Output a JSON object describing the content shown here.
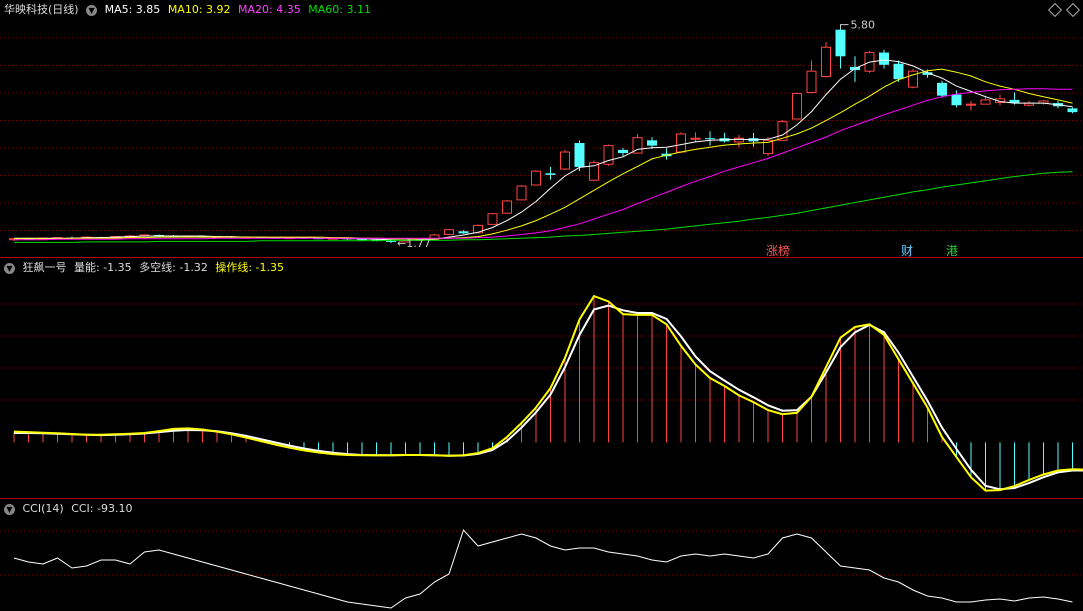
{
  "header": {
    "stock_name": "华映科技(日线)",
    "ma5_label": "MA5: 3.85",
    "ma10_label": "MA10: 3.92",
    "ma20_label": "MA20: 4.35",
    "ma60_label": "MA60: 3.11"
  },
  "indicator1": {
    "name": "狂飙一号",
    "liang_label": "量能: -1.35",
    "duokong_label": "多空线: -1.32",
    "caozuo_label": "操作线: -1.35"
  },
  "indicator2": {
    "name": "CCI(14)",
    "cci_label": "CCI: -93.10"
  },
  "markers": {
    "high_label": "5.80",
    "low_label": "1.77",
    "zhangbang": "涨榜",
    "cai": "财",
    "gang": "港"
  },
  "colors": {
    "up": "#ff4444",
    "down": "#54ffff",
    "ma5": "#ffffff",
    "ma10": "#ffff00",
    "ma20": "#ff00ff",
    "ma60": "#00dd00",
    "grid": "#7a0000"
  },
  "chart_data": [
    {
      "type": "candlestick",
      "title": "华映科技(日线)",
      "ylim": [
        1.6,
        6.0
      ],
      "high_annotation": 5.8,
      "low_annotation": 1.77,
      "candles": [
        [
          1.83,
          1.85,
          1.81,
          1.86
        ],
        [
          1.85,
          1.84,
          1.83,
          1.87
        ],
        [
          1.84,
          1.86,
          1.83,
          1.87
        ],
        [
          1.86,
          1.87,
          1.85,
          1.88
        ],
        [
          1.87,
          1.86,
          1.85,
          1.89
        ],
        [
          1.86,
          1.88,
          1.85,
          1.89
        ],
        [
          1.88,
          1.87,
          1.86,
          1.89
        ],
        [
          1.87,
          1.89,
          1.86,
          1.9
        ],
        [
          1.89,
          1.9,
          1.88,
          1.92
        ],
        [
          1.9,
          1.92,
          1.89,
          1.93
        ],
        [
          1.92,
          1.9,
          1.89,
          1.93
        ],
        [
          1.9,
          1.89,
          1.88,
          1.92
        ],
        [
          1.89,
          1.9,
          1.88,
          1.91
        ],
        [
          1.9,
          1.88,
          1.87,
          1.91
        ],
        [
          1.88,
          1.89,
          1.87,
          1.9
        ],
        [
          1.89,
          1.87,
          1.86,
          1.9
        ],
        [
          1.87,
          1.88,
          1.86,
          1.89
        ],
        [
          1.88,
          1.87,
          1.86,
          1.89
        ],
        [
          1.87,
          1.86,
          1.85,
          1.88
        ],
        [
          1.86,
          1.87,
          1.85,
          1.88
        ],
        [
          1.87,
          1.86,
          1.85,
          1.88
        ],
        [
          1.86,
          1.85,
          1.84,
          1.87
        ],
        [
          1.85,
          1.86,
          1.84,
          1.87
        ],
        [
          1.86,
          1.84,
          1.83,
          1.87
        ],
        [
          1.84,
          1.83,
          1.82,
          1.85
        ],
        [
          1.83,
          1.81,
          1.8,
          1.84
        ],
        [
          1.81,
          1.79,
          1.77,
          1.82
        ],
        [
          1.79,
          1.82,
          1.78,
          1.83
        ],
        [
          1.82,
          1.84,
          1.81,
          1.85
        ],
        [
          1.84,
          1.92,
          1.84,
          1.94
        ],
        [
          1.93,
          2.02,
          1.92,
          2.03
        ],
        [
          1.99,
          1.95,
          1.94,
          2.01
        ],
        [
          1.96,
          2.1,
          1.96,
          2.12
        ],
        [
          2.12,
          2.32,
          2.12,
          2.33
        ],
        [
          2.33,
          2.56,
          2.32,
          2.58
        ],
        [
          2.58,
          2.84,
          2.58,
          2.86
        ],
        [
          2.86,
          3.12,
          2.86,
          3.14
        ],
        [
          3.08,
          3.05,
          2.96,
          3.2
        ],
        [
          3.16,
          3.48,
          3.14,
          3.52
        ],
        [
          3.65,
          3.2,
          3.12,
          3.7
        ],
        [
          2.95,
          3.28,
          2.93,
          3.32
        ],
        [
          3.25,
          3.6,
          3.22,
          3.62
        ],
        [
          3.52,
          3.46,
          3.4,
          3.56
        ],
        [
          3.46,
          3.75,
          3.45,
          3.82
        ],
        [
          3.7,
          3.6,
          3.54,
          3.76
        ],
        [
          3.45,
          3.4,
          3.34,
          3.55
        ],
        [
          3.48,
          3.82,
          3.46,
          3.85
        ],
        [
          3.72,
          3.74,
          3.66,
          3.85
        ],
        [
          3.74,
          3.73,
          3.6,
          3.87
        ],
        [
          3.74,
          3.68,
          3.66,
          3.84
        ],
        [
          3.67,
          3.74,
          3.56,
          3.8
        ],
        [
          3.74,
          3.68,
          3.58,
          3.84
        ],
        [
          3.45,
          3.7,
          3.4,
          3.76
        ],
        [
          3.7,
          4.05,
          3.7,
          4.08
        ],
        [
          4.1,
          4.58,
          4.1,
          4.6
        ],
        [
          4.6,
          5.0,
          4.58,
          5.2
        ],
        [
          4.9,
          5.45,
          4.88,
          5.55
        ],
        [
          5.78,
          5.28,
          5.05,
          5.8
        ],
        [
          5.08,
          5.02,
          4.8,
          5.28
        ],
        [
          5.0,
          5.35,
          4.97,
          5.38
        ],
        [
          5.35,
          5.12,
          5.05,
          5.4
        ],
        [
          5.14,
          4.85,
          4.8,
          5.2
        ],
        [
          4.7,
          5.0,
          4.68,
          5.04
        ],
        [
          4.98,
          4.93,
          4.88,
          5.03
        ],
        [
          4.78,
          4.54,
          4.5,
          4.82
        ],
        [
          4.56,
          4.36,
          4.32,
          4.64
        ],
        [
          4.36,
          4.38,
          4.26,
          4.44
        ],
        [
          4.38,
          4.46,
          4.38,
          4.54
        ],
        [
          4.41,
          4.48,
          4.36,
          4.56
        ],
        [
          4.46,
          4.4,
          4.37,
          4.6
        ],
        [
          4.36,
          4.4,
          4.34,
          4.44
        ],
        [
          4.4,
          4.44,
          4.37,
          4.46
        ],
        [
          4.4,
          4.34,
          4.3,
          4.44
        ],
        [
          4.3,
          4.23,
          4.21,
          4.32
        ]
      ],
      "series": [
        {
          "name": "MA5",
          "color": "#ffffff",
          "values": [
            1.86,
            1.86,
            1.86,
            1.86,
            1.86,
            1.87,
            1.87,
            1.88,
            1.89,
            1.9,
            1.9,
            1.9,
            1.9,
            1.9,
            1.89,
            1.89,
            1.88,
            1.88,
            1.87,
            1.87,
            1.87,
            1.86,
            1.86,
            1.85,
            1.85,
            1.84,
            1.83,
            1.82,
            1.82,
            1.84,
            1.88,
            1.92,
            1.97,
            2.06,
            2.19,
            2.35,
            2.55,
            2.8,
            3.03,
            3.19,
            3.22,
            3.32,
            3.39,
            3.53,
            3.56,
            3.57,
            3.62,
            3.67,
            3.7,
            3.71,
            3.72,
            3.71,
            3.72,
            3.8,
            3.99,
            4.24,
            4.56,
            4.85,
            5.05,
            5.17,
            5.21,
            5.18,
            5.1,
            4.97,
            4.87,
            4.72,
            4.62,
            4.52,
            4.43,
            4.4,
            4.4,
            4.4,
            4.37,
            4.33
          ]
        },
        {
          "name": "MA10",
          "color": "#ffff00",
          "values": [
            1.85,
            1.85,
            1.85,
            1.85,
            1.86,
            1.86,
            1.86,
            1.86,
            1.87,
            1.87,
            1.88,
            1.88,
            1.88,
            1.88,
            1.88,
            1.88,
            1.88,
            1.88,
            1.88,
            1.88,
            1.88,
            1.88,
            1.87,
            1.87,
            1.86,
            1.86,
            1.85,
            1.85,
            1.84,
            1.85,
            1.86,
            1.87,
            1.89,
            1.94,
            2.01,
            2.09,
            2.19,
            2.31,
            2.44,
            2.6,
            2.76,
            2.92,
            3.07,
            3.21,
            3.35,
            3.42,
            3.48,
            3.53,
            3.57,
            3.61,
            3.63,
            3.65,
            3.66,
            3.74,
            3.82,
            3.93,
            4.07,
            4.22,
            4.38,
            4.53,
            4.7,
            4.84,
            4.93,
            5.01,
            5.04,
            4.98,
            4.91,
            4.8,
            4.72,
            4.66,
            4.58,
            4.52,
            4.46,
            4.4
          ]
        },
        {
          "name": "MA20",
          "color": "#ff00ff",
          "values": [
            1.83,
            1.83,
            1.83,
            1.84,
            1.84,
            1.84,
            1.84,
            1.84,
            1.85,
            1.85,
            1.85,
            1.85,
            1.85,
            1.85,
            1.86,
            1.86,
            1.86,
            1.86,
            1.86,
            1.86,
            1.86,
            1.86,
            1.86,
            1.86,
            1.86,
            1.86,
            1.86,
            1.86,
            1.86,
            1.86,
            1.86,
            1.86,
            1.87,
            1.88,
            1.9,
            1.93,
            1.96,
            2.0,
            2.06,
            2.13,
            2.22,
            2.31,
            2.4,
            2.51,
            2.62,
            2.72,
            2.83,
            2.93,
            3.02,
            3.12,
            3.2,
            3.28,
            3.36,
            3.46,
            3.56,
            3.66,
            3.76,
            3.88,
            3.98,
            4.08,
            4.18,
            4.27,
            4.36,
            4.45,
            4.52,
            4.57,
            4.6,
            4.63,
            4.65,
            4.66,
            4.67,
            4.67,
            4.66,
            4.66
          ]
        },
        {
          "name": "MA60",
          "color": "#00dd00",
          "values": [
            1.78,
            1.78,
            1.78,
            1.78,
            1.78,
            1.79,
            1.79,
            1.79,
            1.79,
            1.79,
            1.8,
            1.8,
            1.8,
            1.8,
            1.8,
            1.8,
            1.8,
            1.81,
            1.81,
            1.81,
            1.81,
            1.81,
            1.81,
            1.81,
            1.81,
            1.81,
            1.82,
            1.82,
            1.82,
            1.82,
            1.82,
            1.83,
            1.83,
            1.84,
            1.85,
            1.86,
            1.87,
            1.88,
            1.9,
            1.91,
            1.93,
            1.95,
            1.97,
            1.99,
            2.01,
            2.03,
            2.06,
            2.09,
            2.12,
            2.15,
            2.18,
            2.22,
            2.25,
            2.29,
            2.33,
            2.38,
            2.43,
            2.48,
            2.53,
            2.58,
            2.63,
            2.68,
            2.73,
            2.77,
            2.82,
            2.86,
            2.9,
            2.94,
            2.98,
            3.02,
            3.05,
            3.08,
            3.1,
            3.11
          ]
        }
      ]
    },
    {
      "type": "line",
      "title": "狂飙一号",
      "ylim": [
        -2.0,
        6.2
      ],
      "zero": 0,
      "series": [
        {
          "name": "量能",
          "color": "#ff5555",
          "style": "bar",
          "values": [
            0.4,
            0.38,
            0.36,
            0.34,
            0.31,
            0.28,
            0.28,
            0.3,
            0.32,
            0.35,
            0.42,
            0.5,
            0.52,
            0.48,
            0.4,
            0.3,
            0.18,
            0.05,
            -0.08,
            -0.2,
            -0.3,
            -0.38,
            -0.44,
            -0.47,
            -0.48,
            -0.48,
            -0.48,
            -0.47,
            -0.47,
            -0.48,
            -0.5,
            -0.48,
            -0.4,
            -0.22,
            0.2,
            0.72,
            1.3,
            2.02,
            3.15,
            4.58,
            5.45,
            5.25,
            4.78,
            4.75,
            4.75,
            4.4,
            3.6,
            2.9,
            2.4,
            2.1,
            1.75,
            1.5,
            1.2,
            1.05,
            1.1,
            1.7,
            2.8,
            3.9,
            4.3,
            4.4,
            4.0,
            3.1,
            2.2,
            1.3,
            0.2,
            -0.55,
            -1.3,
            -1.8,
            -1.78,
            -1.63,
            -1.4,
            -1.2,
            -1.05,
            -1.0,
            -1.02,
            -1.35
          ]
        },
        {
          "name": "多空线",
          "color": "#ffffff",
          "values": [
            0.35,
            0.35,
            0.34,
            0.32,
            0.3,
            0.28,
            0.27,
            0.28,
            0.3,
            0.33,
            0.38,
            0.43,
            0.46,
            0.45,
            0.41,
            0.34,
            0.24,
            0.12,
            0.0,
            -0.12,
            -0.23,
            -0.32,
            -0.39,
            -0.44,
            -0.47,
            -0.48,
            -0.48,
            -0.47,
            -0.47,
            -0.48,
            -0.5,
            -0.49,
            -0.43,
            -0.28,
            0.05,
            0.55,
            1.12,
            1.78,
            2.8,
            4.0,
            4.95,
            5.1,
            4.92,
            4.82,
            4.82,
            4.6,
            3.95,
            3.2,
            2.65,
            2.3,
            1.96,
            1.68,
            1.38,
            1.18,
            1.2,
            1.7,
            2.6,
            3.55,
            4.1,
            4.38,
            4.1,
            3.35,
            2.45,
            1.55,
            0.55,
            -0.25,
            -1.02,
            -1.62,
            -1.75,
            -1.7,
            -1.52,
            -1.3,
            -1.12,
            -1.05,
            -1.05,
            -1.32
          ]
        },
        {
          "name": "操作线",
          "color": "#ffff00",
          "values": [
            0.4,
            0.38,
            0.36,
            0.34,
            0.31,
            0.28,
            0.28,
            0.3,
            0.32,
            0.35,
            0.42,
            0.5,
            0.52,
            0.48,
            0.4,
            0.3,
            0.18,
            0.05,
            -0.08,
            -0.2,
            -0.3,
            -0.38,
            -0.44,
            -0.47,
            -0.48,
            -0.48,
            -0.48,
            -0.47,
            -0.47,
            -0.48,
            -0.5,
            -0.48,
            -0.4,
            -0.22,
            0.2,
            0.72,
            1.3,
            2.02,
            3.15,
            4.58,
            5.45,
            5.25,
            4.78,
            4.75,
            4.75,
            4.4,
            3.6,
            2.9,
            2.4,
            2.1,
            1.75,
            1.5,
            1.2,
            1.05,
            1.1,
            1.7,
            2.8,
            3.9,
            4.3,
            4.4,
            4.0,
            3.1,
            2.2,
            1.3,
            0.2,
            -0.55,
            -1.3,
            -1.8,
            -1.78,
            -1.63,
            -1.4,
            -1.2,
            -1.05,
            -1.0,
            -1.02,
            -1.35
          ]
        }
      ]
    },
    {
      "type": "line",
      "title": "CCI(14)",
      "ylim": [
        -200,
        250
      ],
      "series": [
        {
          "name": "CCI",
          "color": "#ffffff",
          "values": [
            40,
            20,
            10,
            40,
            -10,
            0,
            30,
            30,
            10,
            70,
            80,
            60,
            40,
            20,
            0,
            -20,
            -40,
            -60,
            -80,
            -100,
            -120,
            -140,
            -160,
            -180,
            -190,
            -200,
            -210,
            -160,
            -140,
            -80,
            -40,
            180,
            100,
            120,
            140,
            160,
            140,
            100,
            80,
            90,
            90,
            70,
            60,
            50,
            30,
            20,
            50,
            60,
            50,
            60,
            50,
            40,
            60,
            140,
            160,
            140,
            70,
            0,
            -10,
            -20,
            -60,
            -80,
            -120,
            -150,
            -160,
            -180,
            -180,
            -170,
            -165,
            -175,
            -160,
            -155,
            -165,
            -180
          ]
        }
      ]
    }
  ]
}
